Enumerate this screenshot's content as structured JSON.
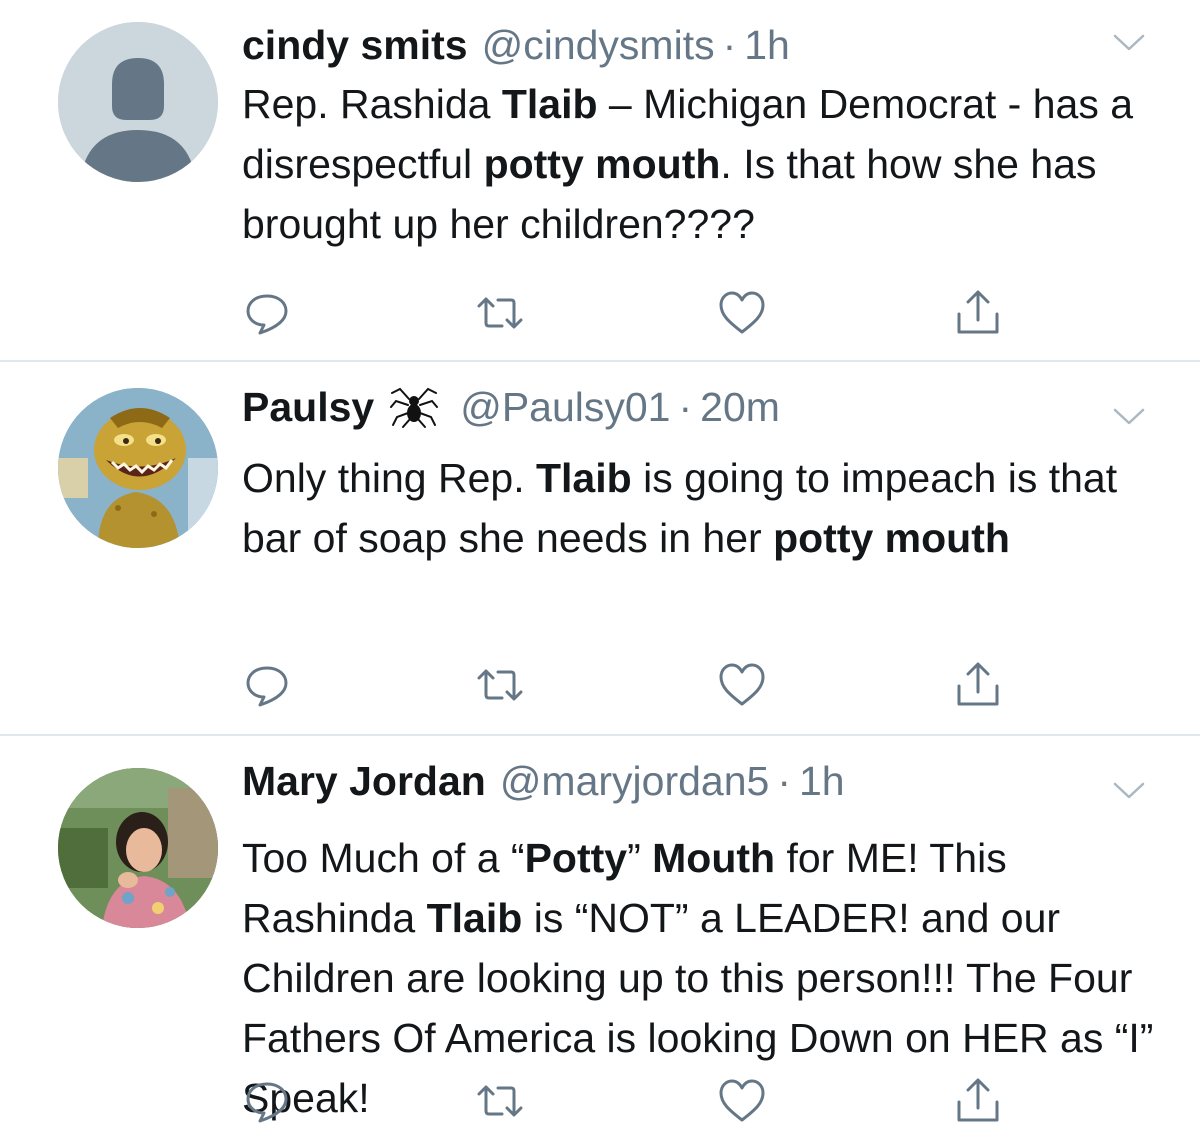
{
  "tweets": [
    {
      "name": "cindy smits",
      "handle": "@cindysmits",
      "separator": "·",
      "time": "1h",
      "body": [
        {
          "t": "Rep. Rashida ",
          "b": false
        },
        {
          "t": "Tlaib",
          "b": true
        },
        {
          "t": " – Michigan Democrat - has a disrespectful ",
          "b": false
        },
        {
          "t": "potty mouth",
          "b": true
        },
        {
          "t": ".  Is that how she has brought up her children????",
          "b": false
        }
      ]
    },
    {
      "name": "Paulsy",
      "name_icon": "spider-icon",
      "handle": "@Paulsy01",
      "separator": "·",
      "time": "20m",
      "body": [
        {
          "t": "Only thing Rep. ",
          "b": false
        },
        {
          "t": "Tlaib",
          "b": true
        },
        {
          "t": " is going to impeach is that bar of soap she needs in her ",
          "b": false
        },
        {
          "t": "potty mouth",
          "b": true
        }
      ]
    },
    {
      "name": "Mary Jordan",
      "handle": "@maryjordan5",
      "separator": "·",
      "time": "1h",
      "body": [
        {
          "t": "Too Much of a “",
          "b": false
        },
        {
          "t": "Potty",
          "b": true
        },
        {
          "t": "” ",
          "b": false
        },
        {
          "t": "Mouth",
          "b": true
        },
        {
          "t": " for ME! This Rashinda ",
          "b": false
        },
        {
          "t": "Tlaib",
          "b": true
        },
        {
          "t": " is “NOT” a LEADER! and our Children are looking up to this person!!! The Four Fathers Of America is looking Down on HER as “I” Speak!",
          "b": false
        }
      ]
    }
  ],
  "icons": {
    "reply": "reply-icon",
    "retweet": "retweet-icon",
    "like": "heart-icon",
    "share": "share-icon",
    "menu": "chevron-down-icon"
  },
  "colors": {
    "text": "#14171a",
    "secondary": "#657786",
    "icon": "#657786",
    "divider": "#e1e8ed",
    "default_avatar_bg": "#ccd6dd",
    "default_avatar_fg": "#657786"
  }
}
